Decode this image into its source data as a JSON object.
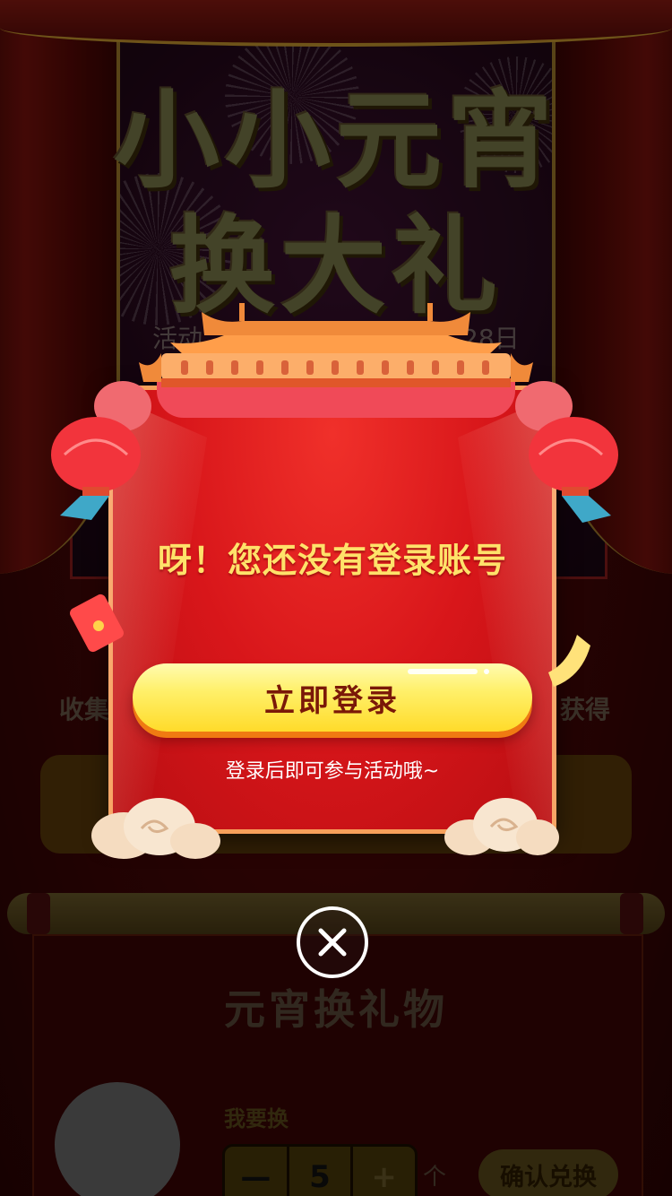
{
  "background": {
    "title_line1": "小小元宵",
    "title_line2": "换大礼",
    "date_prefix": "活动",
    "date_suffix": "28日",
    "collect_text": "收集",
    "obtain_text": "获得"
  },
  "gifts": {
    "section_title": "元宵换礼物",
    "want_label": "我要换",
    "minus_symbol": "—",
    "quantity": "5",
    "plus_symbol": "+",
    "unit": "个",
    "confirm_label": "确认兑换"
  },
  "modal": {
    "message": "呀！您还没有登录账号",
    "login_label": "立即登录",
    "hint": "登录后即可参与活动哦~",
    "close_icon": "close-icon"
  },
  "colors": {
    "modal_red": "#d8161a",
    "message_yellow": "#ffe26a",
    "button_yellow": "#fff06a",
    "button_text": "#7a1808"
  }
}
